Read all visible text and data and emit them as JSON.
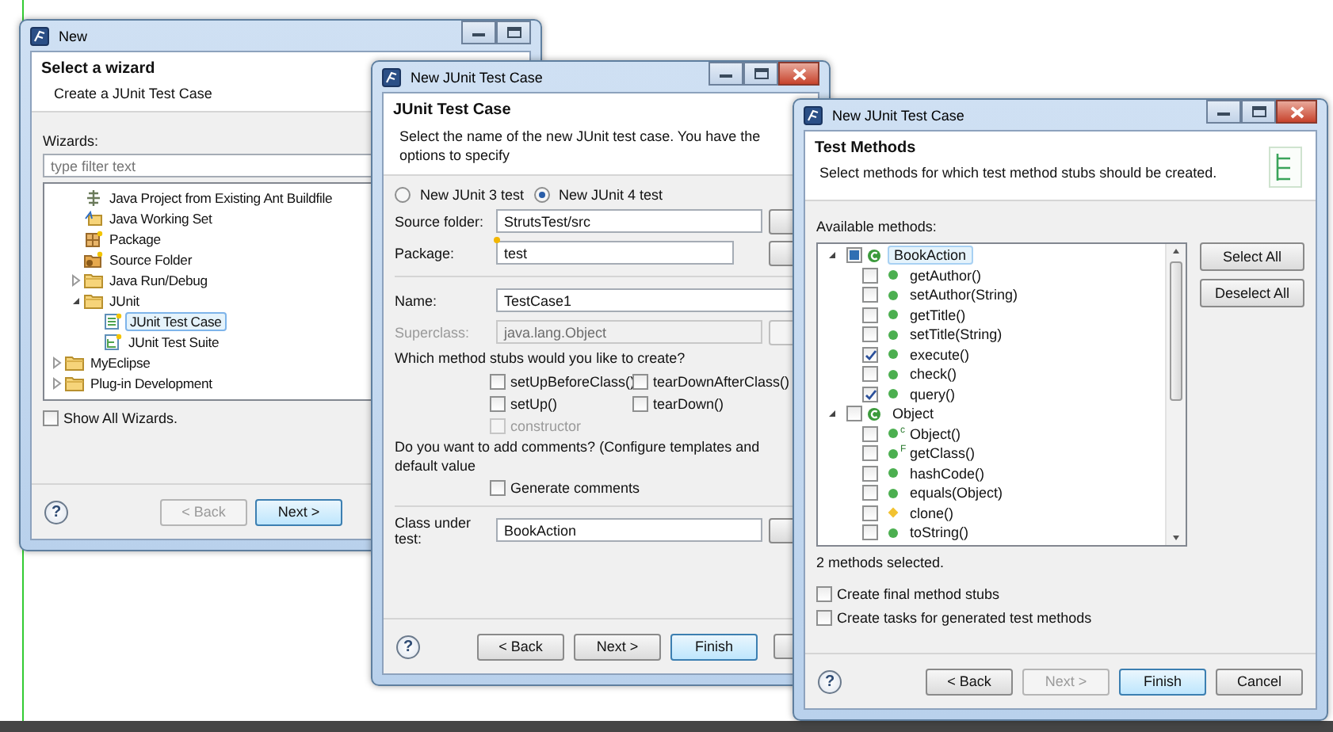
{
  "wizard_window": {
    "title": "New",
    "heading": "Select a wizard",
    "description": "Create a JUnit Test Case",
    "filter_label": "Wizards:",
    "filter": {
      "placeholder": "type filter text"
    },
    "tree_continued": [
      {
        "label": "Java Project from Existing Ant Buildfile",
        "kind": "ant",
        "selected": false
      },
      {
        "label": "Java Working Set",
        "kind": "workingset",
        "selected": false
      },
      {
        "label": "Package",
        "kind": "package",
        "selected": false
      },
      {
        "label": "Source Folder",
        "kind": "srcfolder",
        "selected": false
      },
      {
        "label": "Java Run/Debug",
        "kind": "folder",
        "selected": false,
        "expanded": false
      },
      {
        "label": "JUnit",
        "kind": "folder",
        "selected": false,
        "expanded": true,
        "children": [
          {
            "label": "JUnit Test Case",
            "kind": "testcase",
            "selected": true
          },
          {
            "label": "JUnit Test Suite",
            "kind": "testsuite",
            "selected": false
          }
        ]
      }
    ],
    "tree": [
      {
        "label": "MyEclipse",
        "kind": "folder",
        "selected": false,
        "expanded": false
      },
      {
        "label": "Plug-in Development",
        "kind": "folder",
        "selected": false,
        "expanded": false
      }
    ],
    "show_all": {
      "label": "Show All Wizards.",
      "checked": false
    },
    "help": "?",
    "buttons": [
      {
        "label": "< Back",
        "disabled": true,
        "default": false
      },
      {
        "label": "Next >",
        "disabled": false,
        "default": true
      }
    ]
  },
  "test_case_window": {
    "title": "New JUnit Test Case",
    "heading": "JUnit Test Case",
    "description": "Select the name of the new JUnit test case. You have the options to specify",
    "radios": [
      {
        "label": "New JUnit 3 test",
        "selected": false
      },
      {
        "label": "New JUnit 4 test",
        "selected": true
      }
    ],
    "fields_top": [
      {
        "label": "Source folder:",
        "value": "StrutsTest/src",
        "assist": false,
        "disabled": false,
        "has_button": true
      },
      {
        "label": "Package:",
        "value": "test",
        "assist": true,
        "disabled": false,
        "has_button": true
      }
    ],
    "fields_mid": [
      {
        "label": "Name:",
        "value": "TestCase1",
        "assist": false,
        "disabled": false,
        "has_button": false
      },
      {
        "label": "Superclass:",
        "value": "java.lang.Object",
        "assist": false,
        "disabled": true,
        "has_button": true
      }
    ],
    "stubs_prompt": "Which method stubs would you like to create?",
    "stubs": [
      {
        "label": "setUpBeforeClass()",
        "checked": false,
        "disabled": false
      },
      {
        "label": "tearDownAfterClass()",
        "checked": false,
        "disabled": false
      },
      {
        "label": "setUp()",
        "checked": false,
        "disabled": false
      },
      {
        "label": "tearDown()",
        "checked": false,
        "disabled": false
      },
      {
        "label": "constructor",
        "checked": false,
        "disabled": true
      }
    ],
    "comments_prompt": "Do you want to add comments? (Configure templates and default value",
    "generate_comments": {
      "label": "Generate comments",
      "checked": false
    },
    "fields_bottom": [
      {
        "label": "Class under test:",
        "value": "BookAction",
        "assist": false,
        "disabled": false,
        "has_button": true
      }
    ],
    "help": "?",
    "buttons": [
      {
        "label": "< Back",
        "disabled": false,
        "default": false
      },
      {
        "label": "Next >",
        "disabled": false,
        "default": false
      },
      {
        "label": "Finish",
        "disabled": false,
        "default": true
      }
    ]
  },
  "test_methods_window": {
    "title": "New JUnit Test Case",
    "heading": "Test Methods",
    "description": "Select methods for which test method stubs should be created.",
    "methods_label": "Available methods:",
    "classes": [
      {
        "label": "BookAction",
        "checked": false,
        "grayed": true,
        "selected": true,
        "expanded": true,
        "children": [
          {
            "label": "getAuthor()",
            "checked": false,
            "kind": "public"
          },
          {
            "label": "setAuthor(String)",
            "checked": false,
            "kind": "public"
          },
          {
            "label": "getTitle()",
            "checked": false,
            "kind": "public"
          },
          {
            "label": "setTitle(String)",
            "checked": false,
            "kind": "public"
          },
          {
            "label": "execute()",
            "checked": true,
            "kind": "public"
          },
          {
            "label": "check()",
            "checked": false,
            "kind": "public"
          },
          {
            "label": "query()",
            "checked": true,
            "kind": "public"
          }
        ]
      },
      {
        "label": "Object",
        "checked": false,
        "grayed": false,
        "selected": false,
        "expanded": true,
        "children": [
          {
            "label": "Object()",
            "checked": false,
            "kind": "public",
            "modifier": "c"
          },
          {
            "label": "getClass()",
            "checked": false,
            "kind": "public",
            "modifier": "F"
          },
          {
            "label": "hashCode()",
            "checked": false,
            "kind": "public"
          },
          {
            "label": "equals(Object)",
            "checked": false,
            "kind": "public"
          },
          {
            "label": "clone()",
            "checked": false,
            "kind": "protected"
          },
          {
            "label": "toString()",
            "checked": false,
            "kind": "public"
          }
        ]
      }
    ],
    "side_buttons": [
      "Select All",
      "Deselect All"
    ],
    "status": "2 methods selected.",
    "options": [
      {
        "label": "Create final method stubs",
        "checked": false
      },
      {
        "label": "Create tasks for generated test methods",
        "checked": false
      }
    ],
    "help": "?",
    "buttons": [
      {
        "label": "< Back",
        "disabled": false,
        "default": false
      },
      {
        "label": "Next >",
        "disabled": true,
        "default": false
      },
      {
        "label": "Finish",
        "disabled": false,
        "default": true
      },
      {
        "label": "Cancel",
        "disabled": false,
        "default": false
      }
    ]
  }
}
